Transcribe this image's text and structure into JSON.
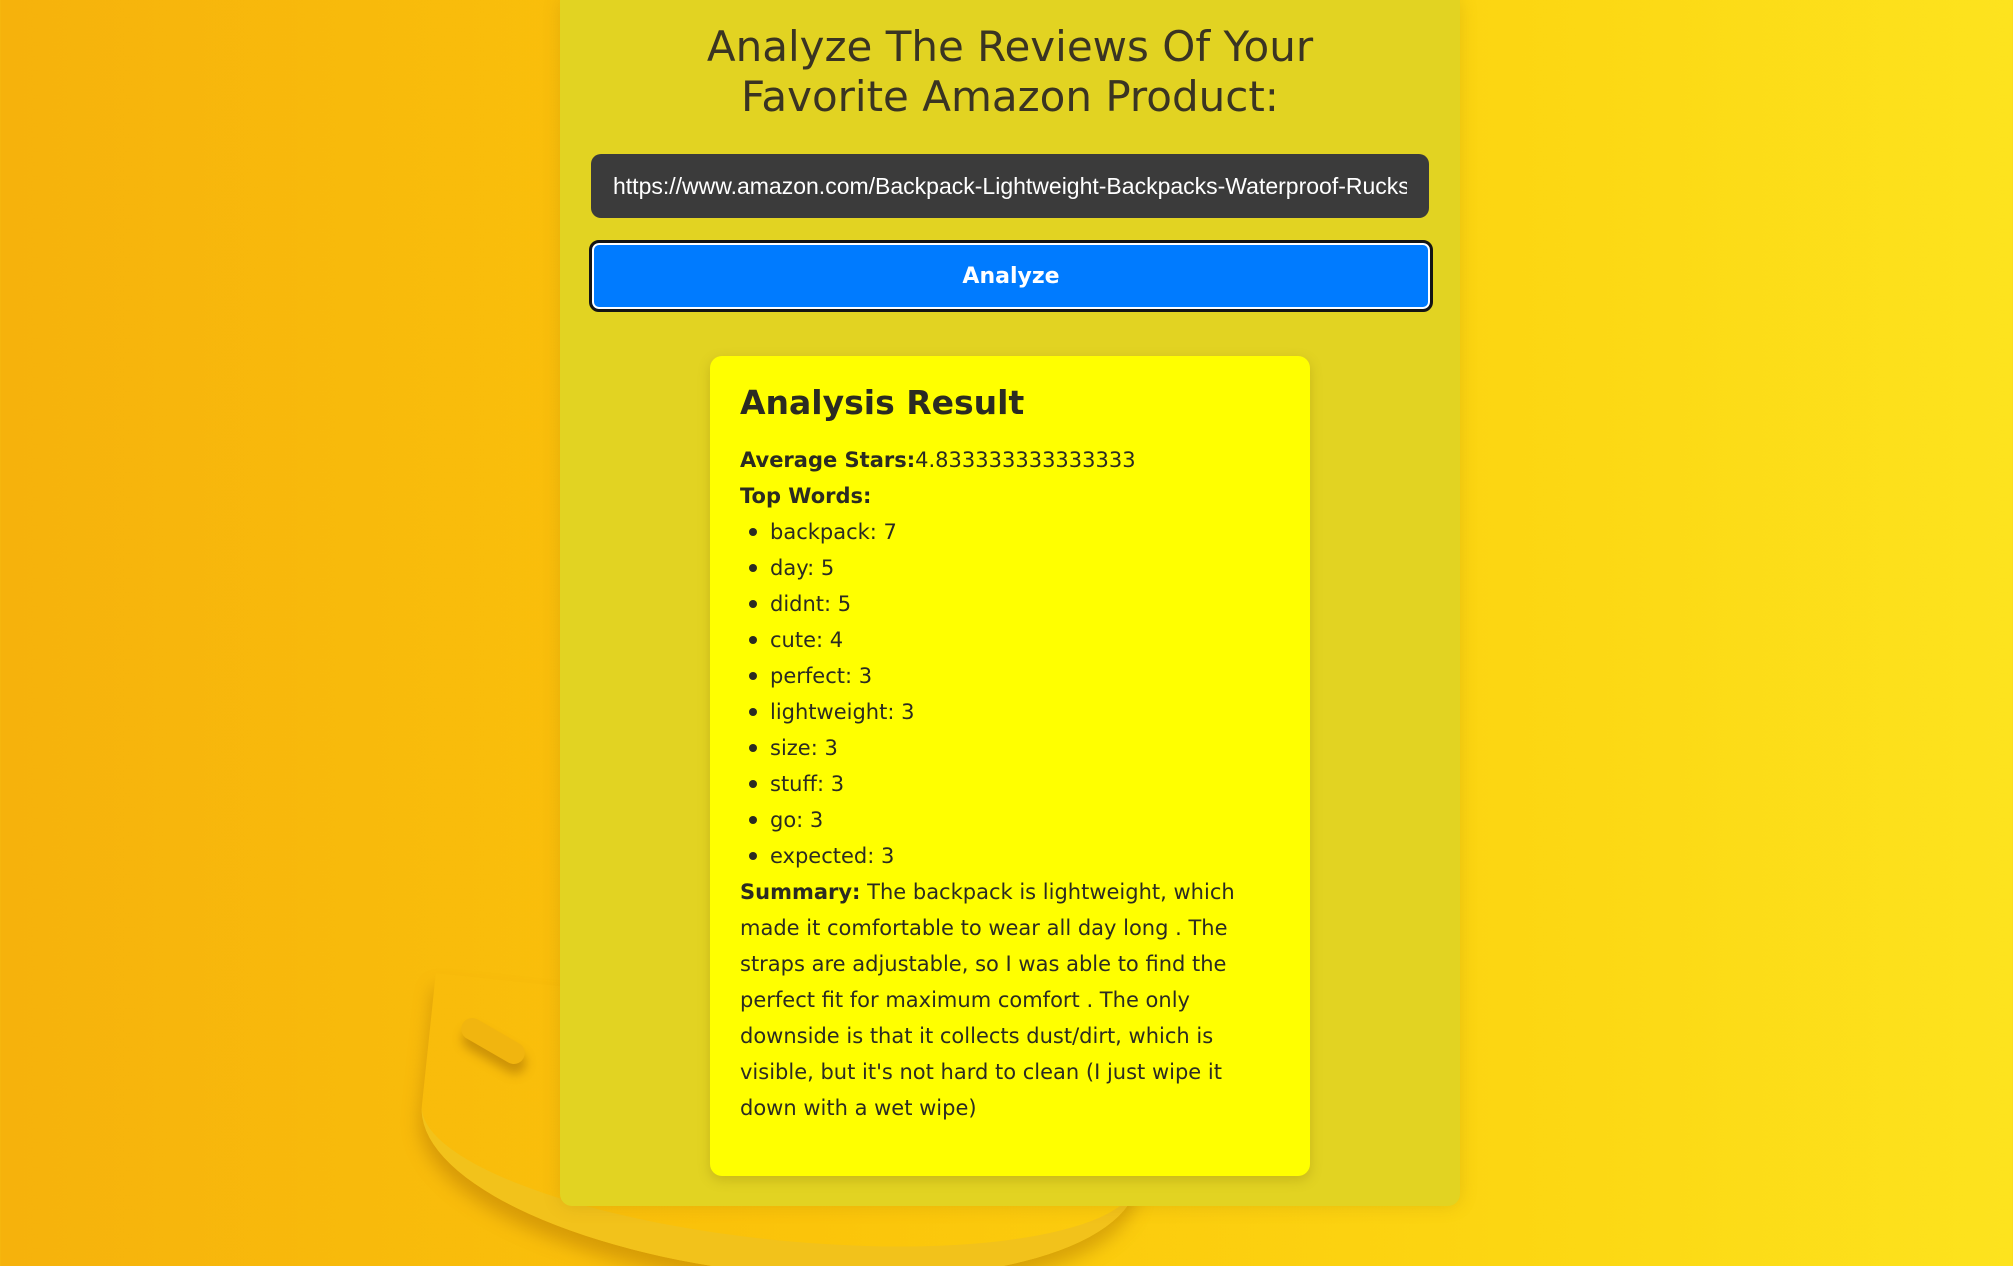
{
  "page": {
    "title": "Analyze The Reviews Of Your Favorite Amazon Product:"
  },
  "form": {
    "url_value": "https://www.amazon.com/Backpack-Lightweight-Backpacks-Waterproof-Rucksack",
    "analyze_label": "Analyze"
  },
  "result": {
    "heading": "Analysis Result",
    "average_stars_label": "Average Stars:",
    "average_stars_value": "4.833333333333333",
    "top_words_label": "Top Words:",
    "top_words": [
      "backpack: 7",
      "day: 5",
      "didnt: 5",
      "cute: 4",
      "perfect: 3",
      "lightweight: 3",
      "size: 3",
      "stuff: 3",
      "go: 3",
      "expected: 3"
    ],
    "summary_label": "Summary:",
    "summary_text": " The backpack is lightweight, which made it comfortable to wear all day long . The straps are adjustable, so I was able to find the perfect fit for maximum comfort . The only downside is that it collects dust/dirt, which is visible, but it's not hard to clean (I just wipe it down with a wet wipe)"
  },
  "colors": {
    "panel": "#e2d322",
    "card": "#ffff00",
    "button": "#007bff",
    "input": "#3b3b3b"
  }
}
